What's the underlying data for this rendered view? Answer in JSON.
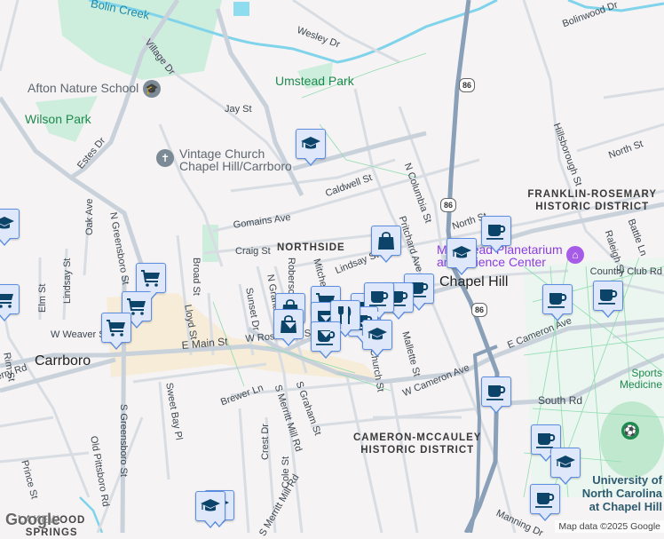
{
  "labels": {
    "bolin_creek": "Bolin Creek",
    "wesley_dr": "Wesley Dr",
    "village_dr": "Village Dr",
    "afton": "Afton Nature School",
    "umstead": "Umstead Park",
    "wilson": "Wilson Park",
    "jay_st": "Jay St",
    "estes": "Estes Dr",
    "vintage_church": "Vintage Church\nChapel Hill/Carrboro",
    "caldwell": "Caldwell St",
    "gomains": "Gomains Ave",
    "craig": "Craig St",
    "northside": "NORTHSIDE",
    "oak_ave": "Oak Ave",
    "n_greensboro": "N Greensboro St",
    "broad": "Broad St",
    "lindsay_w": "Lindsay St",
    "elm": "Elm St",
    "lloyd": "Lloyd St",
    "sunset": "Sunset Dr",
    "n_graham": "N Graham St",
    "roberson": "Roberson St",
    "mitchell": "Mitchell Ln",
    "lindsay_e": "Lindsay St",
    "pritchard": "Pritchard Ave",
    "n_columbia": "N Columbia St",
    "north_st_1": "North St",
    "north_st_2": "North St",
    "hillsborough": "Hillsborough St",
    "bolinwood": "Bolinwood Dr",
    "franklin_rosemary": "FRANKLIN-ROSEMARY\nHISTORIC DISTRICT",
    "battle": "Battle Ln",
    "raleigh": "Raleigh St",
    "planetarium": "Morehead Planetarium\nand Science Center",
    "country_club": "Country Club Rd",
    "chapel_hill": "Chapel Hill",
    "w_weaver": "W Weaver St",
    "e_main": "E Main St",
    "w_rosemary": "W Rosemary St",
    "carrboro": "Carrboro",
    "ferry_rd": "Smith Level Ferry Rd",
    "rim_st": "Rim St",
    "sweet_bay": "Sweet Bay Pl",
    "brewer": "Brewer Ln",
    "s_merritt": "S Merritt Mill Rd",
    "s_graham": "S Graham St",
    "church_st": "Church St",
    "mallette": "Mallette St",
    "w_cameron": "W Cameron Ave",
    "e_cameron": "E Cameron Ave",
    "south_rd": "South Rd",
    "sports": "Sports Medicine",
    "cameron_mccauley": "CAMERON-MCCAULEY\nHISTORIC DISTRICT",
    "s_greensboro": "S Greensboro St",
    "old_pittsboro": "Old Pittsboro Rd",
    "prince": "Prince St",
    "crest": "Crest Dr",
    "cole": "Cole St",
    "merritt_mill_s": "S Merritt Mill Rd",
    "manning": "Manning Dr",
    "unc": "University of\nNorth Carolina\nat Chapel Hill",
    "lakewood": "LAKEWOOD\nSPRINGS"
  },
  "route_shield": "86",
  "attribution": "Map data ©2025 Google",
  "google_logo": "Google",
  "markers": [
    "graduation-cap",
    "graduation-cap",
    "shopping-cart",
    "shopping-cart",
    "shopping-cart",
    "shopping-cart",
    "graduation-cap",
    "graduation-cap",
    "shopping-bag",
    "coffee",
    "coffee",
    "graduation-cap",
    "coffee",
    "coffee",
    "coffee",
    "coffee",
    "graduation-cap",
    "coffee",
    "coffee",
    "shopping-cart",
    "shopping-bag",
    "shopping-bag",
    "coffee",
    "coffee",
    "coffee",
    "coffee",
    "utensils",
    "coffee",
    "graduation-cap"
  ],
  "colors": {
    "marker_fill": "#dfe8fb",
    "marker_border": "#5b8de0",
    "icon": "#0b4468",
    "highway": "#8aa0b8",
    "park": "#cdeedd",
    "water": "#7fd3ea",
    "downtown": "#f6ecd8"
  }
}
